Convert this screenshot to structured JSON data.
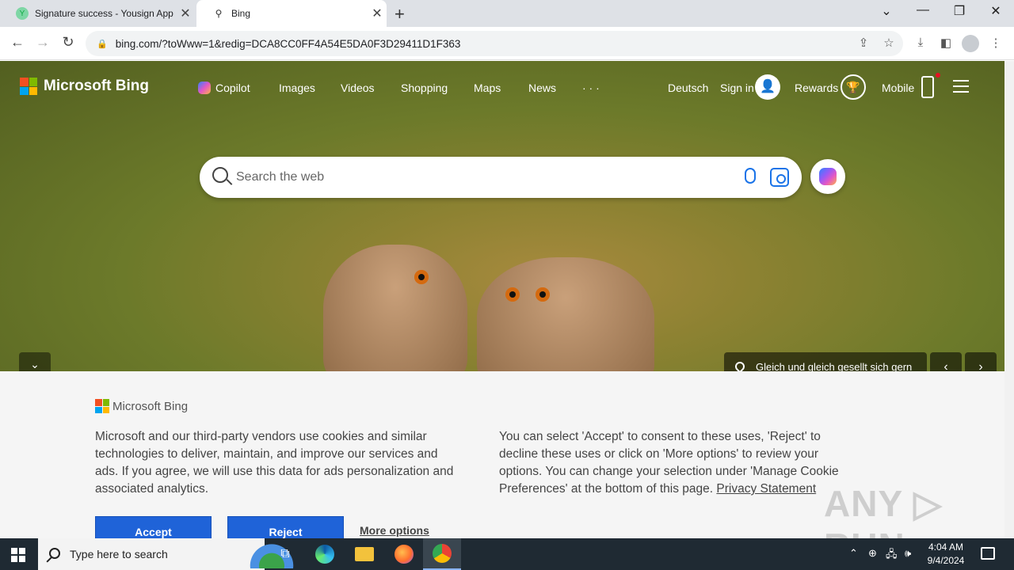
{
  "browser": {
    "tabs": [
      {
        "title": "Signature success - Yousign App",
        "close": "✕"
      },
      {
        "title": "Bing",
        "close": "✕"
      }
    ],
    "new_tab": "+",
    "window_controls": {
      "dropdown": "⌄",
      "minimize": "—",
      "restore": "❐",
      "close": "✕"
    },
    "url": "bing.com/?toWww=1&redig=DCA8CC0FF4A54E5DA0F3D29411D1F363",
    "nav": {
      "back": "←",
      "forward": "→",
      "reload": "↻"
    },
    "toolbar_icons": [
      "share-icon",
      "star-icon",
      "download-icon",
      "sidepanel-icon",
      "profile-icon",
      "kebab-menu-icon"
    ]
  },
  "bing": {
    "brand": "Microsoft Bing",
    "nav": {
      "copilot": "Copilot",
      "images": "Images",
      "videos": "Videos",
      "shopping": "Shopping",
      "maps": "Maps",
      "news": "News",
      "more": "· · ·"
    },
    "language": "Deutsch",
    "sign_in": "Sign in",
    "rewards": "Rewards",
    "mobile": "Mobile",
    "search": {
      "placeholder": "Search the web"
    },
    "image_caption": "Gleich und gleich gesellt sich gern",
    "collapse": "⌄",
    "prev": "‹",
    "next": "›"
  },
  "cookie_banner": {
    "brand": "Microsoft Bing",
    "text_left": "Microsoft and our third-party vendors use cookies and similar technologies to deliver, maintain, and improve our services and ads. If you agree, we will use this data for ads personalization and associated analytics.",
    "text_right": "You can select 'Accept' to consent to these uses, 'Reject' to decline these uses or click on 'More options' to review your options. You can change your selection under 'Manage Cookie Preferences' at the bottom of this page.",
    "privacy_link": "Privacy Statement",
    "accept": "Accept",
    "reject": "Reject",
    "more_options": "More options"
  },
  "watermark": "ANY ▷ RUN",
  "taskbar": {
    "search_placeholder": "Type here to search",
    "time": "4:04 AM",
    "date": "9/4/2024",
    "tray": {
      "chevron": "⌃",
      "speaker": "🕪"
    }
  },
  "colors": {
    "accent_button": "#1f63d8",
    "taskbar": "#1f2a33",
    "cookie_bg": "#f5f5f5"
  }
}
